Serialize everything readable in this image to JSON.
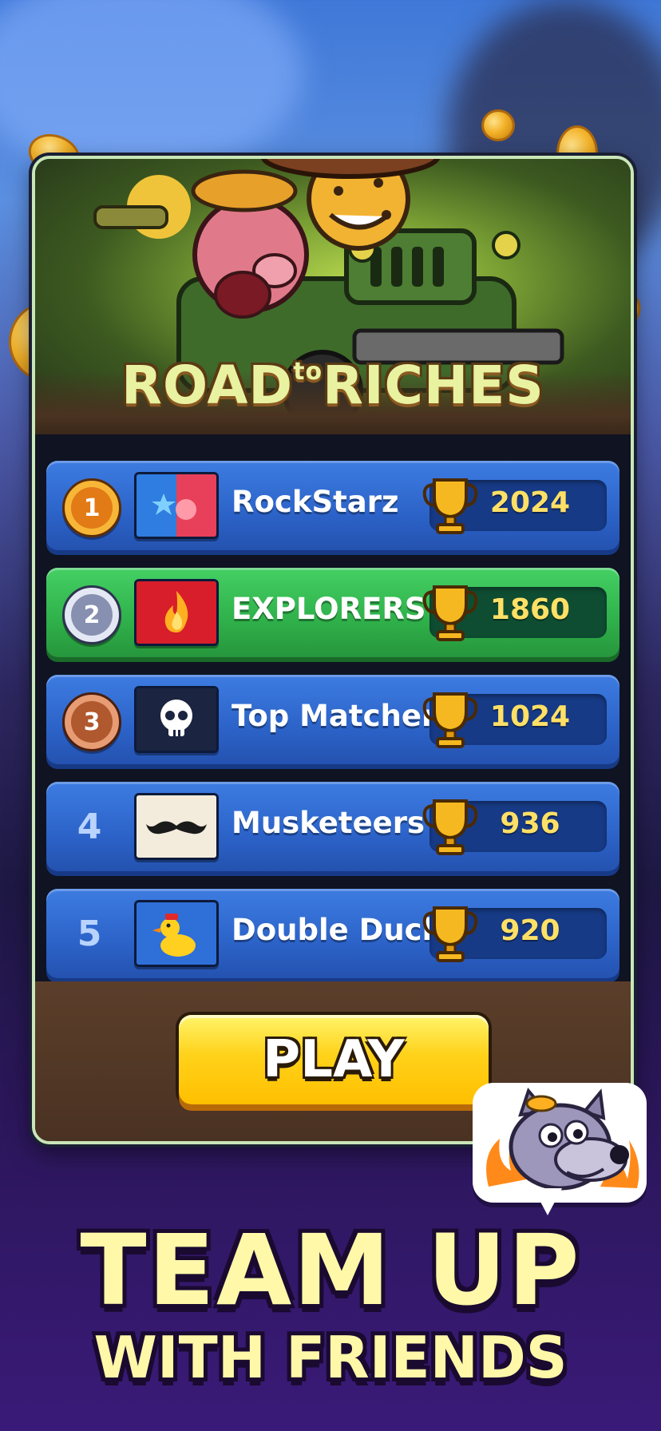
{
  "event": {
    "title_part1": "ROAD",
    "title_part2": "to",
    "title_part3": "RICHES"
  },
  "leaderboard": [
    {
      "rank": "1",
      "medal": "gold",
      "flag": "star-flag",
      "name": "RockStarz",
      "score": "2024",
      "highlighted": false
    },
    {
      "rank": "2",
      "medal": "silver",
      "flag": "fire-flag",
      "name": "EXPLORERS",
      "score": "1860",
      "highlighted": true
    },
    {
      "rank": "3",
      "medal": "bronze",
      "flag": "skull-flag",
      "name": "Top Matchers",
      "score": "1024",
      "highlighted": false
    },
    {
      "rank": "4",
      "medal": "none",
      "flag": "mustache-flag",
      "name": "Musketeers",
      "score": "936",
      "highlighted": false
    },
    {
      "rank": "5",
      "medal": "none",
      "flag": "duck-flag",
      "name": "Double Duck",
      "score": "920",
      "highlighted": false
    }
  ],
  "play_button": {
    "label": "PLAY"
  },
  "promo": {
    "headline": "TEAM UP",
    "subheadline": "WITH FRIENDS"
  },
  "colors": {
    "row_blue": "#2c63c8",
    "row_green": "#2fb04a",
    "score_yellow": "#ffe066",
    "play_yellow": "#ffd21a",
    "headline_yellow": "#fff8a8"
  }
}
